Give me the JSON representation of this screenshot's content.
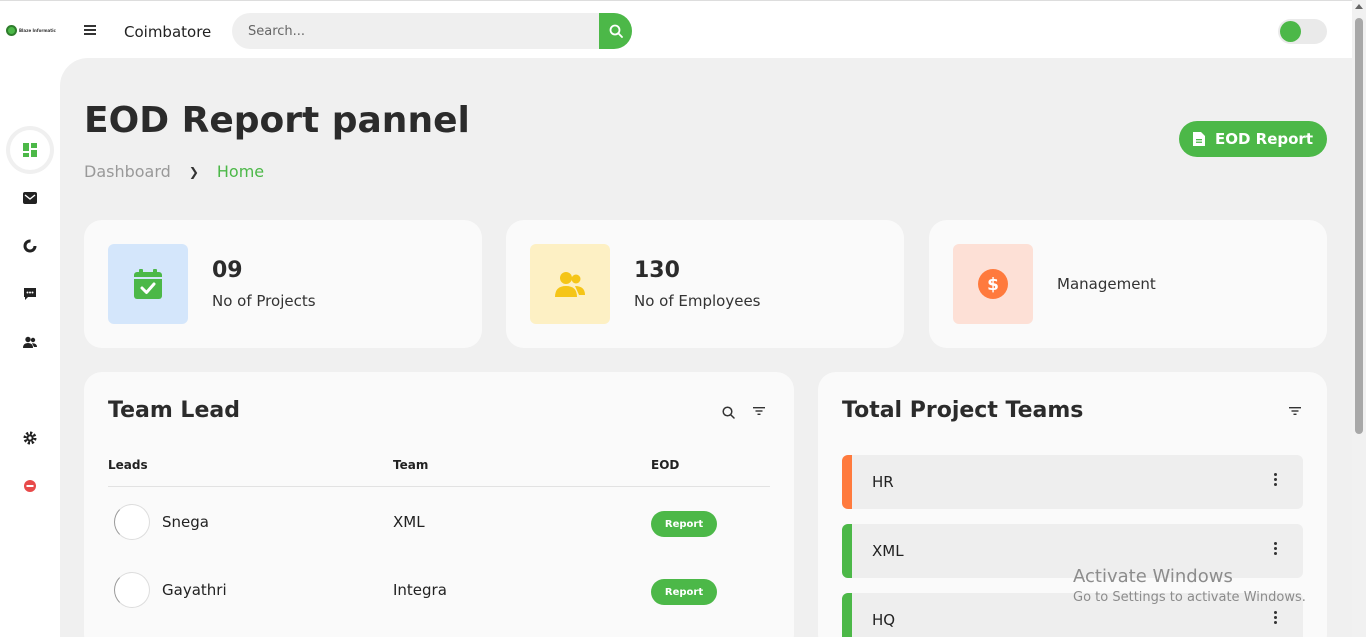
{
  "topbar": {
    "logo_text": "Blaze Informatic",
    "city": "Coimbatore",
    "search_placeholder": "Search..."
  },
  "sidebar": {
    "items": [
      {
        "icon": "dashboard-icon",
        "active": true
      },
      {
        "icon": "inbox-icon"
      },
      {
        "icon": "chart-icon"
      },
      {
        "icon": "chat-icon"
      },
      {
        "icon": "users-icon"
      },
      {
        "icon": "settings-icon"
      },
      {
        "icon": "logout-icon"
      }
    ]
  },
  "header": {
    "title": "EOD Report pannel",
    "breadcrumb": [
      "Dashboard",
      "Home"
    ],
    "eod_button": "EOD Report"
  },
  "stats": [
    {
      "value": "09",
      "label": "No of Projects",
      "icon": "calendar-check-icon",
      "bg": "#d4e6fb",
      "fg": "#4cb848"
    },
    {
      "value": "130",
      "label": "No of Employees",
      "icon": "users-icon",
      "bg": "#fdf0c4",
      "fg": "#f5c518"
    },
    {
      "value": "",
      "label": "Management",
      "icon": "dollar-icon",
      "bg": "#fde0d6",
      "fg": "#ff7a3d"
    }
  ],
  "team_lead": {
    "title": "Team Lead",
    "columns": [
      "Leads",
      "Team",
      "EOD"
    ],
    "rows": [
      {
        "name": "Snega",
        "team": "XML",
        "action": "Report"
      },
      {
        "name": "Gayathri",
        "team": "Integra",
        "action": "Report"
      }
    ]
  },
  "project_teams": {
    "title": "Total Project Teams",
    "teams": [
      {
        "name": "HR",
        "color": "#ff7a3d"
      },
      {
        "name": "XML",
        "color": "#4cb848"
      },
      {
        "name": "HQ",
        "color": "#4cb848"
      }
    ]
  },
  "watermark": {
    "line1": "Activate Windows",
    "line2": "Go to Settings to activate Windows."
  },
  "colors": {
    "accent": "#4cb848",
    "background": "#f0f0f0",
    "card": "#fafafa"
  }
}
